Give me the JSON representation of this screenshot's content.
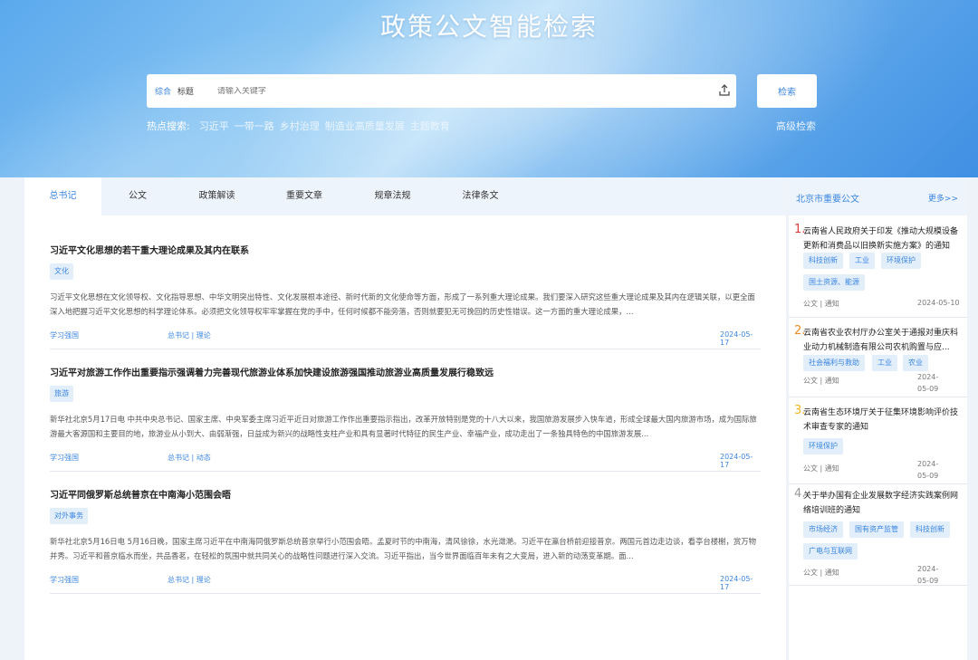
{
  "header": {
    "title": "政策公文智能检索",
    "search": {
      "scope_options": [
        "综合",
        "标题"
      ],
      "placeholder": "请输入关键字",
      "button": "检索"
    },
    "hot_label": "热点搜索:",
    "hot_keywords": [
      "习近平",
      "一带一路",
      "乡村治理",
      "制造业高质量发展",
      "主题教育"
    ],
    "advanced": "高级检索"
  },
  "tabs": [
    "总书记",
    "公文",
    "政策解读",
    "重要文章",
    "规章法规",
    "法律条文"
  ],
  "articles": [
    {
      "title": "习近平文化思想的若干重大理论成果及其内在联系",
      "tag": "文化",
      "body": "习近平文化思想在文化领导权、文化指导思想、中华文明突出特性、文化发展根本途径、新时代新的文化使命等方面，形成了一系列重大理论成果。我们要深入研究这些重大理论成果及其内在逻辑关联，以更全面深入地把握习近平文化思想的科学理论体系。必须把文化领导权牢牢掌握在党的手中，任何时候都不能旁落，否则就要犯无可挽回的历史性错误。这一方面的重大理论成果，...",
      "source": "学习强国",
      "category": "总书记 | 理论",
      "date": "2024-05-17"
    },
    {
      "title": "习近平对旅游工作作出重要指示强调着力完善现代旅游业体系加快建设旅游强国推动旅游业高质量发展行稳致远",
      "tag": "旅游",
      "body": "新华社北京5月17日电 中共中央总书记、国家主席、中央军委主席习近平近日对旅游工作作出重要指示指出，改革开放特别是党的十八大以来，我国旅游发展步入快车道，形成全球最大国内旅游市场，成为国际旅游最大客源国和主要目的地，旅游业从小到大、由弱渐强，日益成为新兴的战略性支柱产业和具有显著时代特征的民生产业、幸福产业，成功走出了一条独具特色的中国旅游发展...",
      "source": "学习强国",
      "category": "总书记 | 动态",
      "date": "2024-05-17"
    },
    {
      "title": "习近平同俄罗斯总统普京在中南海小范围会晤",
      "tag": "对外事务",
      "body": "新华社北京5月16日电 5月16日晚，国家主席习近平在中南海同俄罗斯总统普京举行小范围会晤。孟夏时节的中南海，清风徐徐，水光潋滟。习近平在瀛台桥前迎接普京。两国元首边走边谈，看亭台楼榭，赏万物并秀。习近平和普京临水而坐，共品香茗，在轻松的氛围中就共同关心的战略性问题进行深入交流。习近平指出，当今世界面临百年未有之大变局，进入新的动荡变革期。面...",
      "source": "学习强国",
      "category": "总书记 | 理论",
      "date": "2024-05-17"
    }
  ],
  "sidebar": {
    "title": "北京市重要公文",
    "more": "更多>>",
    "items": [
      {
        "num": "1.",
        "num_color": "#e23b3b",
        "title": "云南省人民政府关于印发《推动大规模设备更新和消费品以旧换新实施方案》的通知",
        "tags": [
          "科技创新",
          "工业",
          "环境保护",
          "国土资源、能源"
        ],
        "meta": "公文 | 通知",
        "date": "2024-05-10"
      },
      {
        "num": "2.",
        "num_color": "#f08a24",
        "title": "云南省农业农村厅办公室关于通报对重庆科业动力机械制造有限公司农机购置与应...",
        "tags": [
          "社会福利与救助",
          "工业",
          "农业"
        ],
        "meta": "公文 | 通知",
        "date": "2024-05-09"
      },
      {
        "num": "3.",
        "num_color": "#f2b61d",
        "title": "云南省生态环境厅关于征集环境影响评价技术审查专家的通知",
        "tags": [
          "环境保护"
        ],
        "meta": "公文 | 通知",
        "date": "2024-05-09"
      },
      {
        "num": "4.",
        "num_color": "#999999",
        "title": "关于举办国有企业发展数字经济实践案例网络培训班的通知",
        "tags": [
          "市场经济",
          "国有资产监管",
          "科技创新",
          "广电与互联网"
        ],
        "meta": "公文 | 通知",
        "date": "2024-05-09"
      }
    ]
  }
}
